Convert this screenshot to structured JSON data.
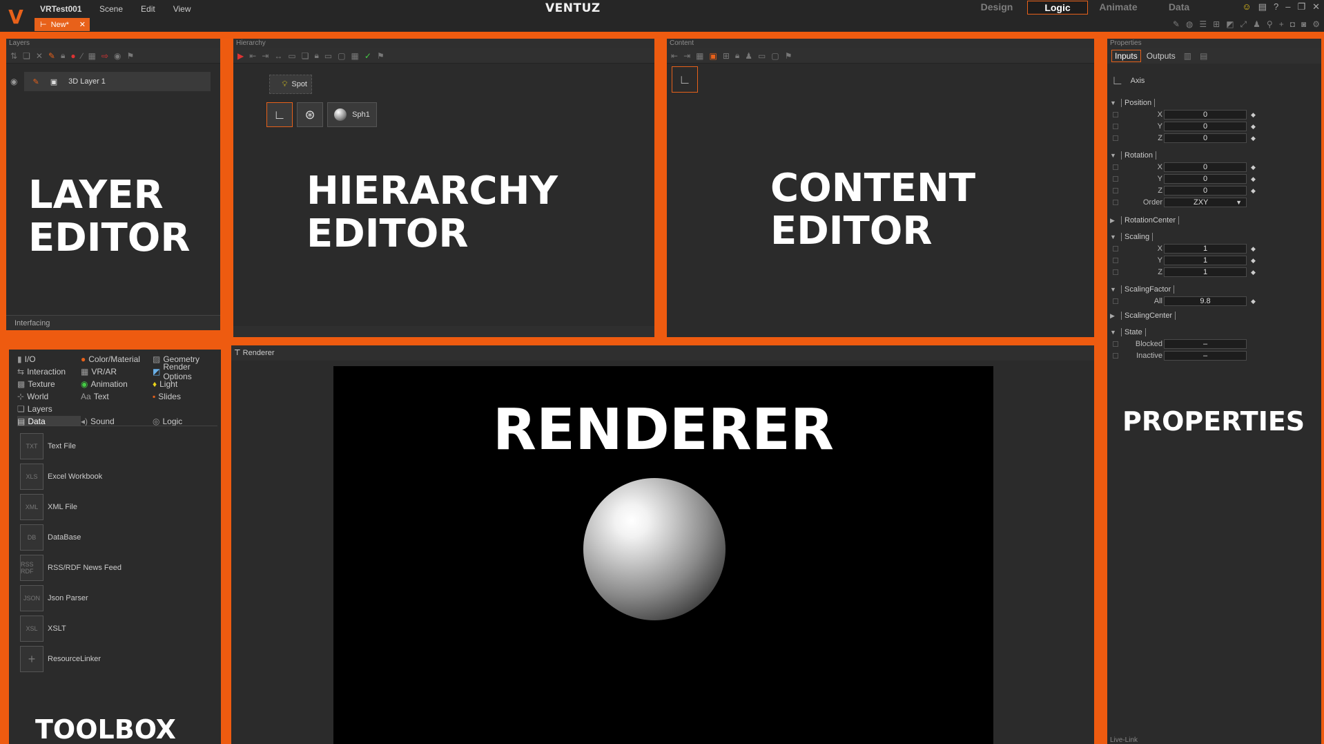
{
  "app": {
    "project_title": "VRTest001",
    "brand": "VENTUZ",
    "logo_glyph": "V",
    "menu": [
      "Scene",
      "Edit",
      "View"
    ],
    "doc_tab": "New*",
    "mode_tabs": [
      "Design",
      "Logic",
      "Animate",
      "Data"
    ],
    "active_mode": "Logic",
    "accent_color": "#ee5b10"
  },
  "layers": {
    "title": "Layers",
    "layer_name": "3D Layer 1",
    "footer": "Interfacing",
    "overlay_line1": "LAYER",
    "overlay_line2": "EDITOR"
  },
  "hierarchy": {
    "title": "Hierarchy",
    "nodes": {
      "spot": "Spot",
      "sphere": "Sph1"
    },
    "overlay_line1": "HIERARCHY",
    "overlay_line2": "EDITOR"
  },
  "content": {
    "title": "Content",
    "overlay_line1": "CONTENT",
    "overlay_line2": "EDITOR"
  },
  "toolbox": {
    "categories": [
      "I/O",
      "Color/Material",
      "Geometry",
      "Interaction",
      "VR/AR",
      "Render Options",
      "Texture",
      "Animation",
      "Light",
      "World",
      "Text",
      "Slides",
      "Layers",
      "Data",
      "Sound",
      "Logic"
    ],
    "selected_category": "Data",
    "items": [
      {
        "icon": "TXT",
        "label": "Text File"
      },
      {
        "icon": "XLS",
        "label": "Excel Workbook"
      },
      {
        "icon": "XML",
        "label": "XML File"
      },
      {
        "icon": "DB",
        "label": "DataBase"
      },
      {
        "icon": "RSS RDF",
        "label": "RSS/RDF News Feed"
      },
      {
        "icon": "JSON",
        "label": "Json Parser"
      },
      {
        "icon": "XSL",
        "label": "XSLT"
      },
      {
        "icon": "+",
        "label": "ResourceLinker"
      }
    ],
    "overlay": "TOOLBOX"
  },
  "renderer": {
    "title": "Renderer",
    "overlay": "RENDERER"
  },
  "properties": {
    "title": "Properties",
    "tabs": [
      "Inputs",
      "Outputs"
    ],
    "active_tab": "Inputs",
    "node_name": "Axis",
    "groups": {
      "position": {
        "name": "Position",
        "x": "0",
        "y": "0",
        "z": "0"
      },
      "rotation": {
        "name": "Rotation",
        "x": "0",
        "y": "0",
        "z": "0",
        "order_label": "Order",
        "order": "ZXY"
      },
      "rotation_center": {
        "name": "RotationCenter"
      },
      "scaling": {
        "name": "Scaling",
        "x": "1",
        "y": "1",
        "z": "1"
      },
      "scaling_factor": {
        "name": "ScalingFactor",
        "all_label": "All",
        "all": "9.8"
      },
      "scaling_center": {
        "name": "ScalingCenter"
      },
      "state": {
        "name": "State",
        "blocked_label": "Blocked",
        "blocked": "–",
        "inactive_label": "Inactive",
        "inactive": "–"
      }
    },
    "axis_labels": {
      "x": "X",
      "y": "Y",
      "z": "Z"
    },
    "footer": "Live-Link",
    "overlay": "PROPERTIES"
  }
}
